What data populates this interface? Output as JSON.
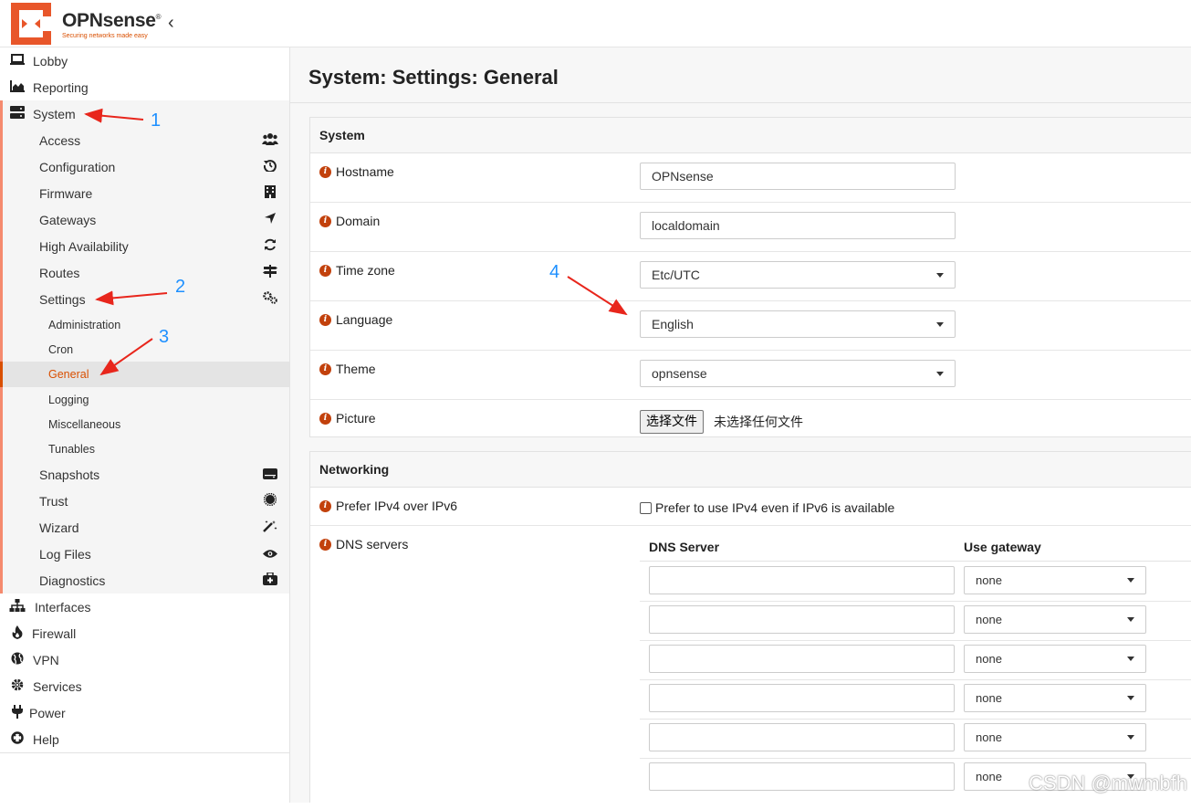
{
  "brand": {
    "name": "OPNsense",
    "mark": "®",
    "tagline": "Securing networks made easy",
    "collapse_icon": "‹"
  },
  "sidebar": {
    "top_items": [
      {
        "label": "Lobby",
        "icon": "laptop-icon"
      },
      {
        "label": "Reporting",
        "icon": "area-chart-icon"
      },
      {
        "label": "System",
        "icon": "server-icon"
      }
    ],
    "system_items": [
      {
        "label": "Access",
        "icon": "users-icon"
      },
      {
        "label": "Configuration",
        "icon": "history-icon"
      },
      {
        "label": "Firmware",
        "icon": "building-icon"
      },
      {
        "label": "Gateways",
        "icon": "location-arrow-icon"
      },
      {
        "label": "High Availability",
        "icon": "refresh-icon"
      },
      {
        "label": "Routes",
        "icon": "map-signs-icon"
      },
      {
        "label": "Settings",
        "icon": "cogs-icon"
      }
    ],
    "settings_items": [
      "Administration",
      "Cron",
      "General",
      "Logging",
      "Miscellaneous",
      "Tunables"
    ],
    "active_item": "General",
    "system_items_after": [
      {
        "label": "Snapshots",
        "icon": "hdd-icon"
      },
      {
        "label": "Trust",
        "icon": "certificate-icon"
      },
      {
        "label": "Wizard",
        "icon": "magic-icon"
      },
      {
        "label": "Log Files",
        "icon": "eye-icon"
      },
      {
        "label": "Diagnostics",
        "icon": "medkit-icon"
      }
    ],
    "bottom_items": [
      {
        "label": "Interfaces",
        "icon": "sitemap-icon"
      },
      {
        "label": "Firewall",
        "icon": "fire-icon"
      },
      {
        "label": "VPN",
        "icon": "globe-icon"
      },
      {
        "label": "Services",
        "icon": "cog-icon"
      },
      {
        "label": "Power",
        "icon": "plug-icon"
      },
      {
        "label": "Help",
        "icon": "life-ring-icon"
      }
    ]
  },
  "page": {
    "title": "System: Settings: General"
  },
  "system_section": {
    "heading": "System",
    "hostname": {
      "label": "Hostname",
      "value": "OPNsense"
    },
    "domain": {
      "label": "Domain",
      "value": "localdomain"
    },
    "timezone": {
      "label": "Time zone",
      "value": "Etc/UTC"
    },
    "language": {
      "label": "Language",
      "value": "English"
    },
    "theme": {
      "label": "Theme",
      "value": "opnsense"
    },
    "picture": {
      "label": "Picture",
      "button": "选择文件",
      "status": "未选择任何文件"
    }
  },
  "networking_section": {
    "heading": "Networking",
    "prefer_ipv4": {
      "label": "Prefer IPv4 over IPv6",
      "checkbox_text": "Prefer to use IPv4 even if IPv6 is available",
      "checked": false
    },
    "dns": {
      "label": "DNS servers",
      "col_server": "DNS Server",
      "col_gateway": "Use gateway",
      "rows": [
        {
          "server": "",
          "gateway": "none"
        },
        {
          "server": "",
          "gateway": "none"
        },
        {
          "server": "",
          "gateway": "none"
        },
        {
          "server": "",
          "gateway": "none"
        },
        {
          "server": "",
          "gateway": "none"
        },
        {
          "server": "",
          "gateway": "none"
        }
      ]
    }
  },
  "annotations": [
    "1",
    "2",
    "3",
    "4"
  ],
  "watermark": "CSDN @mwmbfh",
  "colors": {
    "accent": "#d94f00",
    "arrow": "#e8261c",
    "annotation_number": "#1e90ff",
    "info_icon": "#c2410c"
  }
}
